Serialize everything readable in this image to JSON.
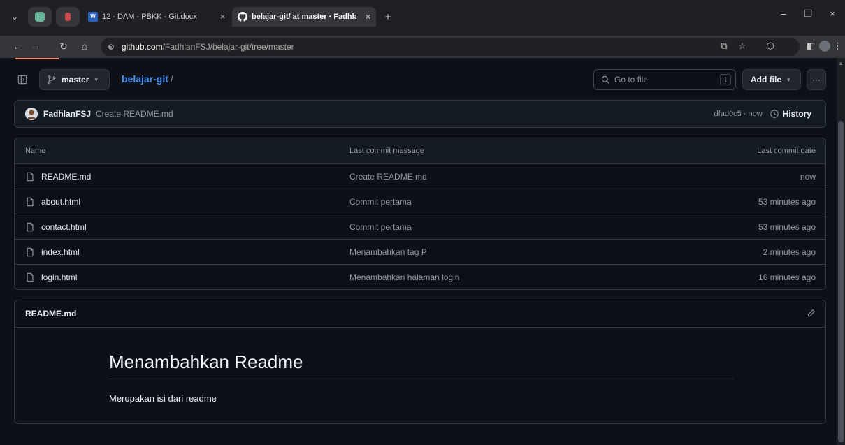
{
  "browser": {
    "tabs": [
      {
        "title": "12 - DAM - PBKK - Git.docx",
        "close": "×"
      },
      {
        "title": "belajar-git/ at master · Fadhlan",
        "close": "×"
      }
    ],
    "new_tab": "+",
    "window_controls": {
      "minimize": "–",
      "restore": "❐",
      "close": "×"
    },
    "url_host": "github.com",
    "url_path": "/FadhlanFSJ/belajar-git/tree/master"
  },
  "repo": {
    "branch": "master",
    "breadcrumb_repo": "belajar-git",
    "breadcrumb_sep": "/",
    "search_placeholder": "Go to file",
    "search_shortcut": "t",
    "add_file_label": "Add file",
    "more_label": "···"
  },
  "latest_commit": {
    "author": "FadhlanFSJ",
    "message": "Create README.md",
    "sha_time": "dfad0c5 · now",
    "history_label": "History"
  },
  "file_table": {
    "headers": {
      "name": "Name",
      "message": "Last commit message",
      "date": "Last commit date"
    },
    "rows": [
      {
        "name": "README.md",
        "message": "Create README.md",
        "date": "now"
      },
      {
        "name": "about.html",
        "message": "Commit pertama",
        "date": "53 minutes ago"
      },
      {
        "name": "contact.html",
        "message": "Commit pertama",
        "date": "53 minutes ago"
      },
      {
        "name": "index.html",
        "message": "Menambahkan tag P",
        "date": "2 minutes ago"
      },
      {
        "name": "login.html",
        "message": "Menambahkan halaman login",
        "date": "16 minutes ago"
      }
    ]
  },
  "readme": {
    "filename": "README.md",
    "heading": "Menambahkan Readme",
    "paragraph": "Merupakan isi dari readme"
  },
  "colors": {
    "accent_link": "#4493f8",
    "background": "#0d1117",
    "border": "#30363d",
    "muted": "#9198a1"
  },
  "icons": [
    "chevron-down-icon",
    "chatgpt-icon",
    "word-icon",
    "github-icon",
    "back-icon",
    "forward-icon",
    "reload-icon",
    "home-icon",
    "site-settings-icon",
    "cast-icon",
    "bookmark-star-icon",
    "extensions-icon",
    "sidepanel-icon",
    "profile-icon",
    "menu-icon",
    "sidebar-toggle-icon",
    "branch-icon",
    "search-icon",
    "history-icon",
    "file-icon",
    "pencil-icon"
  ]
}
